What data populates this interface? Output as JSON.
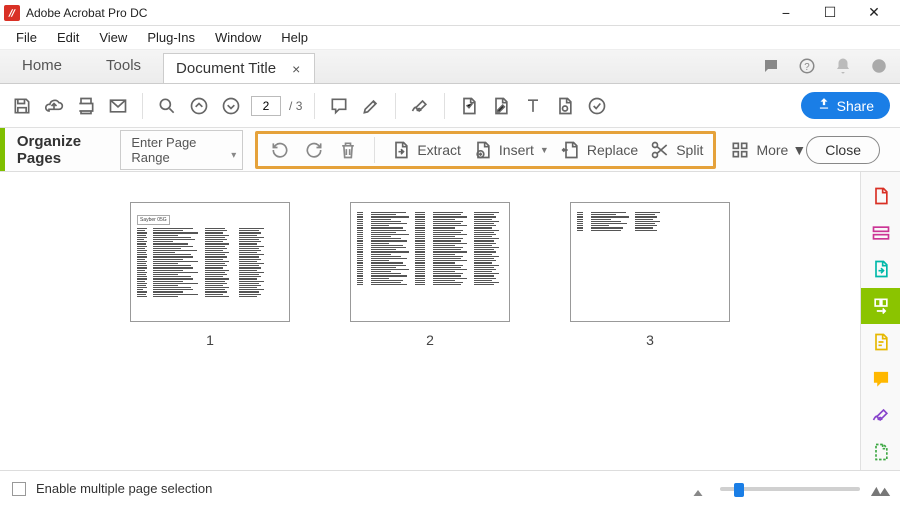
{
  "app": {
    "title": "Adobe Acrobat Pro DC"
  },
  "menu": [
    "File",
    "Edit",
    "View",
    "Plug-Ins",
    "Window",
    "Help"
  ],
  "navtabs": {
    "home": "Home",
    "tools": "Tools"
  },
  "doc_tab": {
    "title": "Document Title"
  },
  "page": {
    "current": "2",
    "total": "3",
    "sep": "/"
  },
  "share": "Share",
  "organize": {
    "title": "Organize Pages",
    "page_range": "Enter Page Range",
    "extract": "Extract",
    "insert": "Insert",
    "replace": "Replace",
    "split": "Split",
    "more": "More",
    "close": "Close"
  },
  "thumbs": [
    {
      "index": "1",
      "header": "Sayber 05G"
    },
    {
      "index": "2"
    },
    {
      "index": "3"
    }
  ],
  "footer": {
    "checkbox_label": "Enable multiple page selection"
  },
  "icons": {
    "search_glyph": "🔍",
    "bell_glyph": "🔔"
  }
}
